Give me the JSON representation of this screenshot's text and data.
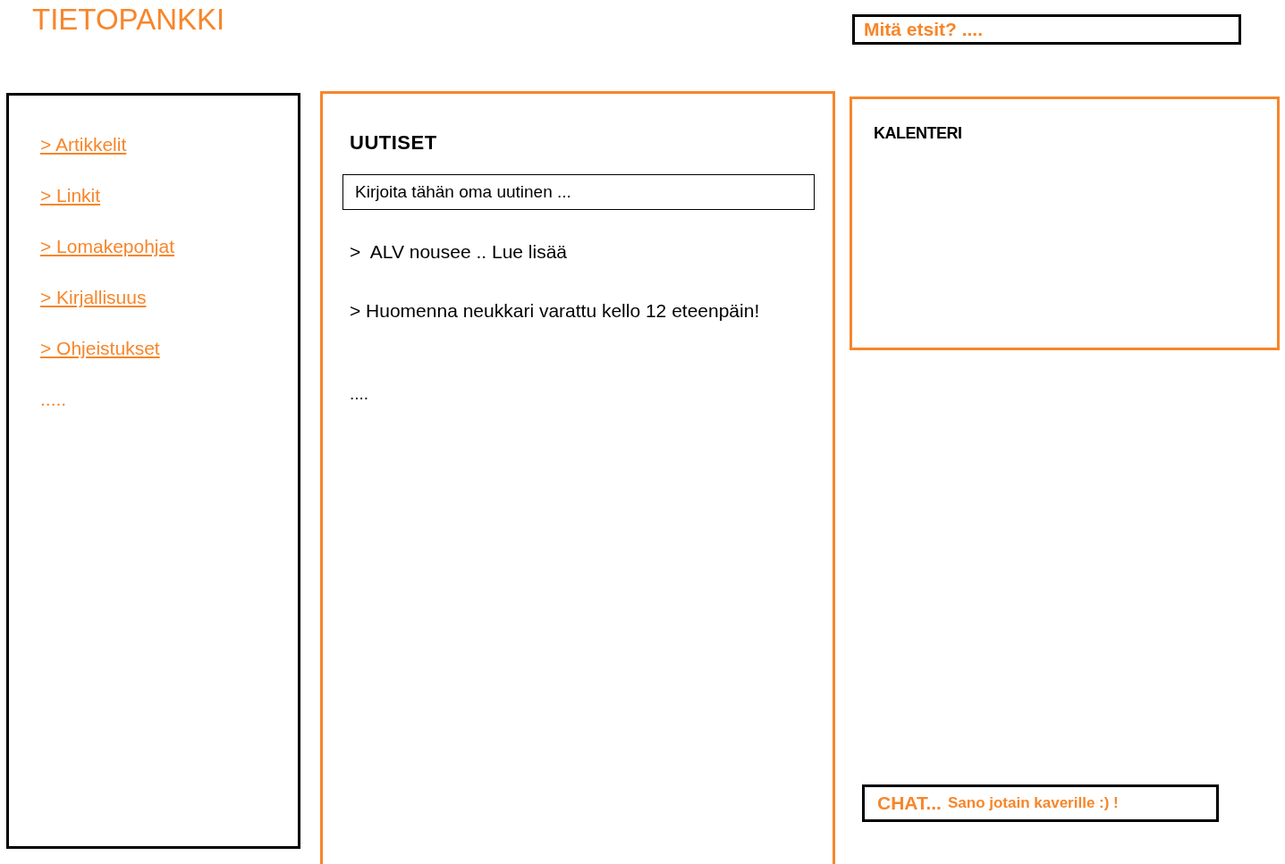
{
  "header": {
    "title": "TIETOPANKKI"
  },
  "search": {
    "placeholder": "Mitä etsit? ...."
  },
  "sidebar": {
    "items": [
      {
        "label": "> Artikkelit"
      },
      {
        "label": "> Linkit"
      },
      {
        "label": "> Lomakepohjat"
      },
      {
        "label": "> Kirjallisuus"
      },
      {
        "label": "> Ohjeistukset"
      }
    ],
    "more": "....."
  },
  "news": {
    "title": "UUTISET",
    "input": {
      "placeholder": "Kirjoita tähän oma uutinen ..."
    },
    "items": [
      ">  ALV nousee .. Lue lisää",
      "> Huomenna neukkari varattu kello 12 eteenpäin!"
    ],
    "more": "...."
  },
  "calendar": {
    "title": "KALENTERI"
  },
  "chat": {
    "label": "CHAT...",
    "placeholder": "Sano jotain kaverille :) !"
  }
}
